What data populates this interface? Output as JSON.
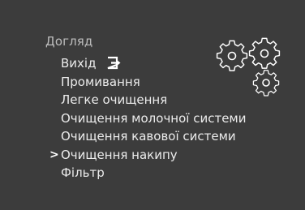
{
  "menu": {
    "title": "Догляд",
    "cursor_glyph": ">",
    "items": [
      {
        "label": "Вихід",
        "icon": "exit-icon"
      },
      {
        "label": "Промивання"
      },
      {
        "label": "Легке очищення"
      },
      {
        "label": "Очищення молочної системи"
      },
      {
        "label": "Очищення кавової системи"
      },
      {
        "label": "Очищення накипу",
        "selected": true
      },
      {
        "label": "Фільтр"
      }
    ]
  },
  "decoration": {
    "icon": "gears-icon"
  },
  "colors": {
    "background": "#3c3c3c",
    "text": "#ececec",
    "title_text": "#bdbdbd",
    "icon_stroke": "#ffffff"
  }
}
